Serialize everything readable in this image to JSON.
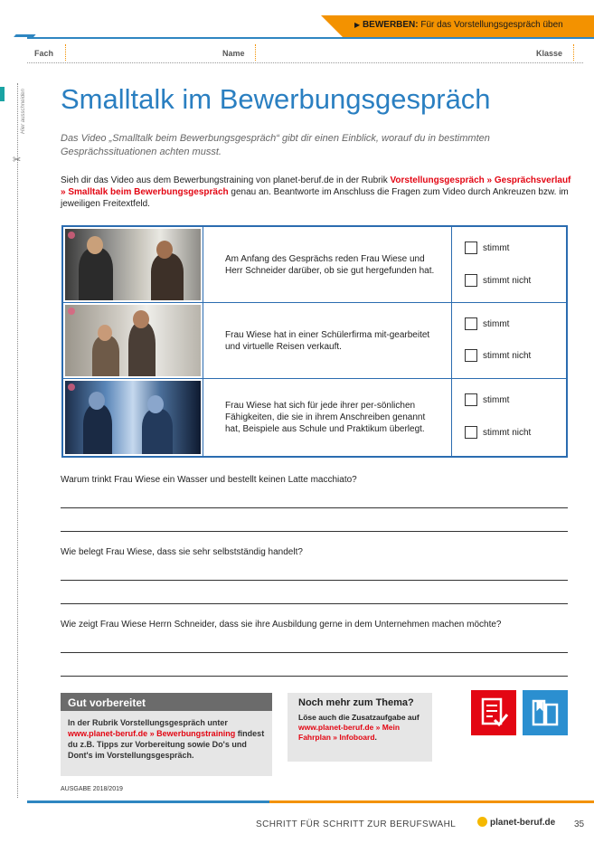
{
  "banner": {
    "label": "BEWERBEN:",
    "text": "Für das Vorstellungsgespräch üben"
  },
  "fields": {
    "fach": "Fach",
    "name": "Name",
    "klasse": "Klasse"
  },
  "margin": {
    "cut_hint": "Hier ausschneiden"
  },
  "title": "Smalltalk im Bewerbungsgespräch",
  "intro": "Das Video „Smalltalk beim Bewerbungsgespräch“ gibt dir einen Einblick, worauf du in bestimmten Gesprächssituationen achten musst.",
  "instructions": {
    "part1": "Sieh dir das Video aus dem Bewerbungstraining von planet-beruf.de in der Rubrik ",
    "link": "Vorstellungsgespräch » Gesprächsverlauf » Smalltalk beim Bewerbungsgespräch",
    "part2": " genau an. Beantworte im Anschluss die Fragen zum Video durch Ankreuzen bzw. im jeweiligen Freitextfeld."
  },
  "statements": [
    {
      "text": "Am Anfang des Gesprächs reden Frau Wiese und Herr Schneider darüber, ob sie gut hergefunden hat.",
      "opt_true": "stimmt",
      "opt_false": "stimmt nicht"
    },
    {
      "text": "Frau Wiese hat in einer Schülerfirma mit-gearbeitet und virtuelle Reisen verkauft.",
      "opt_true": "stimmt",
      "opt_false": "stimmt nicht"
    },
    {
      "text": "Frau Wiese hat sich für jede ihrer per-sönlichen Fähigkeiten, die sie in ihrem Anschreiben genannt hat, Beispiele aus Schule und Praktikum überlegt.",
      "opt_true": "stimmt",
      "opt_false": "stimmt nicht"
    }
  ],
  "questions": [
    "Warum trinkt Frau Wiese ein Wasser und bestellt keinen Latte macchiato?",
    "Wie belegt Frau Wiese, dass sie sehr selbstständig handelt?",
    "Wie zeigt Frau Wiese Herrn Schneider, dass sie ihre Ausbildung gerne in dem Unternehmen machen möchte?"
  ],
  "gut_vorbereitet": {
    "heading": "Gut vorbereitet",
    "text1": "In der Rubrik Vorstellungsgespräch unter ",
    "link": "www.planet-beruf.de » Bewerbungstraining",
    "text2": " findest du z.B. Tipps zur Vorbereitung sowie Do's und Dont's im Vorstellungsgespräch."
  },
  "noch_mehr": {
    "heading": "Noch mehr zum Thema?",
    "text1": "Löse auch die Zusatzaufgabe auf ",
    "link": "www.planet-beruf.de » Mein Fahrplan » Infoboard",
    "text2": "."
  },
  "icons": {
    "left": "checklist-icon",
    "right": "book-icon",
    "red": "#e30613",
    "blue": "#2b8fd0"
  },
  "edition": "AUSGABE 2018/2019",
  "footer": {
    "slogan": "SCHRITT FÜR SCHRITT ZUR BERUFSWAHL",
    "logo": "planet-beruf.de",
    "page": "35"
  },
  "colors": {
    "accent_orange": "#f39200",
    "accent_blue": "#2a7fc1",
    "highlight_red": "#e30613"
  }
}
